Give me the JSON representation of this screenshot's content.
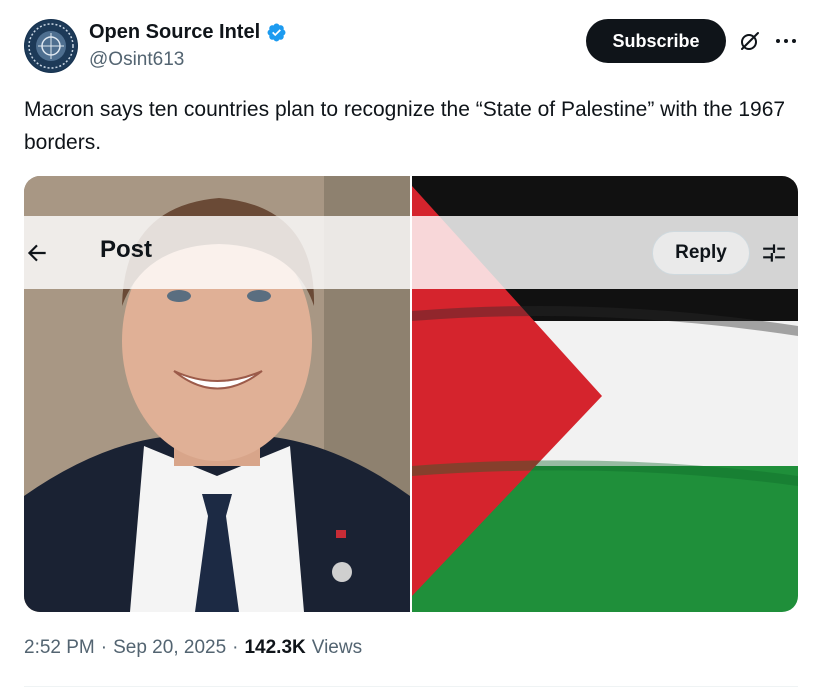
{
  "author": {
    "display_name": "Open Source Intel",
    "handle": "@Osint613",
    "verified": true,
    "verified_color": "#1d9bf0"
  },
  "actions": {
    "subscribe_label": "Subscribe",
    "grok_icon": "grok-slash-circle-icon",
    "more_icon": "more-horizontal-icon"
  },
  "tweet": {
    "text": "Macron says ten countries plan to recognize the “State of Palestine” with the 1967 borders."
  },
  "media": {
    "images": [
      "portrait-photo",
      "palestinian-flag-photo"
    ]
  },
  "overlay_header": {
    "back_icon": "arrow-left-icon",
    "title": "Post",
    "reply_label": "Reply",
    "settings_icon": "sliders-icon"
  },
  "meta": {
    "time": "2:52 PM",
    "separator": "·",
    "date": "Sep 20, 2025",
    "views_count": "142.3K",
    "views_label": "Views"
  },
  "colors": {
    "text_primary": "#0f1419",
    "text_secondary": "#536471",
    "button_dark": "#0f1419",
    "flag_black": "#111111",
    "flag_white": "#f2f2f2",
    "flag_green": "#1f8f3a",
    "flag_red": "#d5242d"
  }
}
